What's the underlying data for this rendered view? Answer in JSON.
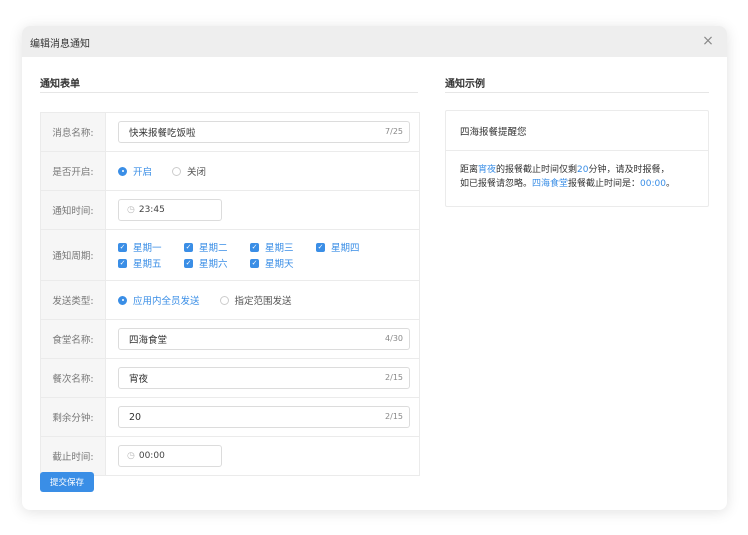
{
  "dialog": {
    "title": "编辑消息通知",
    "close_icon": "×"
  },
  "form_section_title": "通知表单",
  "preview_section_title": "通知示例",
  "fields": {
    "name": {
      "label": "消息名称:",
      "value": "快来报餐吃饭啦",
      "count": "7/25"
    },
    "enabled": {
      "label": "是否开启:",
      "options": [
        "开启",
        "关闭"
      ],
      "selected": "开启"
    },
    "notify_time": {
      "label": "通知时间:",
      "value": "23:45"
    },
    "period": {
      "label": "通知周期:",
      "days": [
        "星期一",
        "星期二",
        "星期三",
        "星期四",
        "星期五",
        "星期六",
        "星期天"
      ]
    },
    "send_type": {
      "label": "发送类型:",
      "options": [
        "应用内全员发送",
        "指定范围发送"
      ],
      "selected": "应用内全员发送"
    },
    "canteen": {
      "label": "食堂名称:",
      "value": "四海食堂",
      "count": "4/30"
    },
    "meal": {
      "label": "餐次名称:",
      "value": "宵夜",
      "count": "2/15"
    },
    "minutes": {
      "label": "剩余分钟:",
      "value": "20",
      "count": "2/15"
    },
    "deadline": {
      "label": "截止时间:",
      "value": "00:00"
    }
  },
  "submit_label": "提交保存",
  "preview": {
    "title": "四海报餐提醒您",
    "line1_a": "距离",
    "line1_meal": "宵夜",
    "line1_b": "的报餐截止时间仅剩",
    "line1_min": "20",
    "line1_c": "分钟，请及时报餐，",
    "line2_a": "如已报餐请忽略。",
    "line2_canteen": "四海食堂",
    "line2_b": "报餐截止时间是：",
    "line2_time": "00:00",
    "line2_c": "。"
  },
  "colors": {
    "accent": "#3a8ee6",
    "header_bg": "#eeeeee",
    "label_bg": "#f6f6f6"
  }
}
